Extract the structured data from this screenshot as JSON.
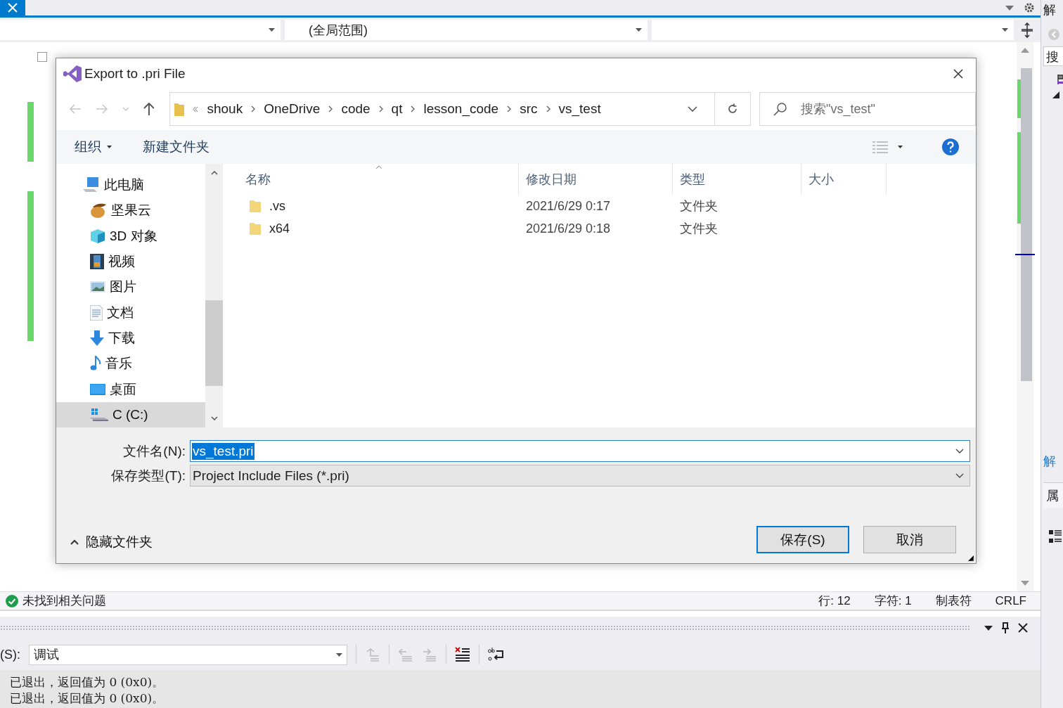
{
  "editor": {
    "scope": "(全局范围)"
  },
  "side_panel": {
    "title": "解",
    "search": "搜",
    "link": "解",
    "properties": "属"
  },
  "status_bar": {
    "message": "未找到相关问题",
    "line": "行: 12",
    "column": "字符: 1",
    "indent": "制表符",
    "eol": "CRLF"
  },
  "output": {
    "source_label": "(S):",
    "source": "调试",
    "lines": [
      "已退出，返回值为 0 (0x0)。",
      "已退出，返回值为 0 (0x0)。"
    ]
  },
  "dialog": {
    "title": "Export to .pri File",
    "path": [
      "shouk",
      "OneDrive",
      "code",
      "qt",
      "lesson_code",
      "src",
      "vs_test"
    ],
    "search_placeholder": "搜索\"vs_test\"",
    "toolbar": {
      "organize": "组织",
      "new_folder": "新建文件夹"
    },
    "tree": [
      {
        "label": "此电脑",
        "kind": "computer",
        "selected": false,
        "children": [
          {
            "label": "坚果云",
            "kind": "nut",
            "selected": false
          },
          {
            "label": "3D 对象",
            "kind": "cube",
            "selected": false
          },
          {
            "label": "视频",
            "kind": "video",
            "selected": false
          },
          {
            "label": "图片",
            "kind": "picture",
            "selected": false
          },
          {
            "label": "文档",
            "kind": "document",
            "selected": false
          },
          {
            "label": "下载",
            "kind": "download",
            "selected": false
          },
          {
            "label": "音乐",
            "kind": "music",
            "selected": false
          },
          {
            "label": "桌面",
            "kind": "desktop",
            "selected": false
          },
          {
            "label": "C (C:)",
            "kind": "drive",
            "selected": true
          }
        ]
      }
    ],
    "columns": [
      "名称",
      "修改日期",
      "类型",
      "大小"
    ],
    "files": [
      {
        "name": ".vs",
        "modified": "2021/6/29 0:17",
        "type": "文件夹"
      },
      {
        "name": "x64",
        "modified": "2021/6/29 0:18",
        "type": "文件夹"
      }
    ],
    "file_name_label": "文件名(N):",
    "file_name": {
      "value": "vs_test.pri",
      "selected": true
    },
    "file_type_label": "保存类型(T):",
    "file_type": "Project Include Files (*.pri)",
    "hide_folders": "隐藏文件夹",
    "buttons": [
      {
        "label": "保存(S)",
        "kind": "primary"
      },
      {
        "label": "取消",
        "kind": "secondary"
      }
    ]
  }
}
